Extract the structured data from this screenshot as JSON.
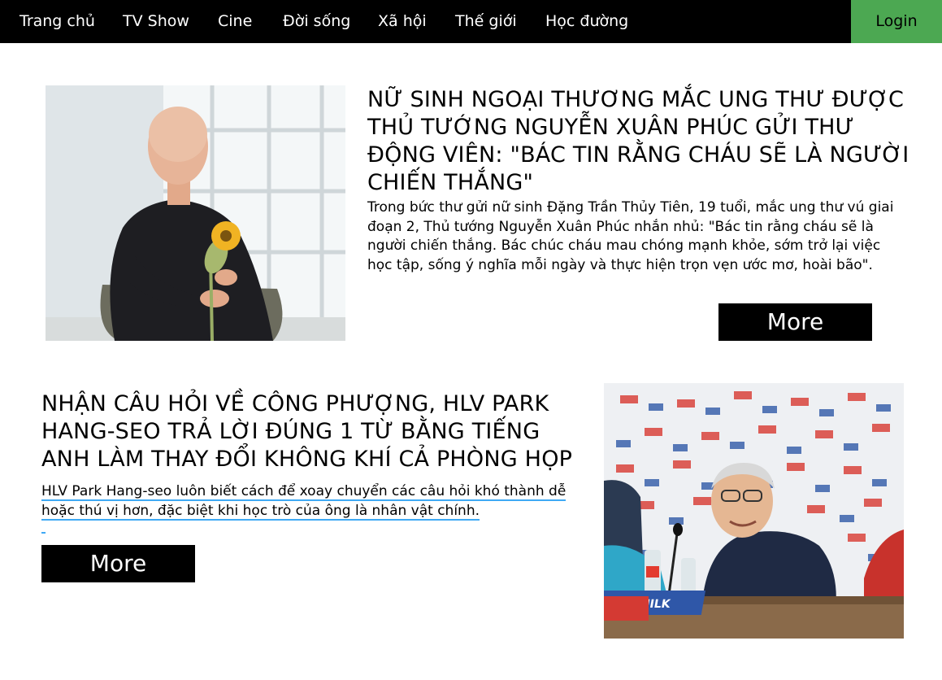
{
  "nav": {
    "items": [
      {
        "label": "Trang chủ"
      },
      {
        "label": "TV Show"
      },
      {
        "label": "Cine"
      },
      {
        "label": "Đời sống"
      },
      {
        "label": "Xã hội"
      },
      {
        "label": "Thế giới"
      },
      {
        "label": "Học đường"
      }
    ],
    "login_label": "Login",
    "login_color": "#4ca852"
  },
  "articles": [
    {
      "title": "NỮ SINH NGOẠI THƯƠNG MẮC UNG THƯ ĐƯỢC THỦ TƯỚNG NGUYỄN XUÂN PHÚC GỬI THƯ ĐỘNG VIÊN: \"BÁC TIN RẰNG CHÁU SẼ LÀ NGƯỜI CHIẾN THẮNG\"",
      "summary": "Trong bức thư gửi nữ sinh Đặng Trần Thủy Tiên, 19 tuổi, mắc ung thư vú giai đoạn 2, Thủ tướng Nguyễn Xuân Phúc nhắn nhủ: \"Bác tin rằng cháu sẽ là người chiến thắng. Bác chúc cháu mau chóng mạnh khỏe, sớm trở lại việc học tập, sống ý nghĩa mỗi ngày và thực hiện trọn vẹn ước mơ, hoài bão\".",
      "more_label": "More"
    },
    {
      "title": "NHẬN CÂU HỎI VỀ CÔNG PHƯỢNG, HLV PARK HANG-SEO TRẢ LỜI ĐÚNG 1 TỪ BẰNG TIẾNG ANH LÀM THAY ĐỔI KHÔNG KHÍ CẢ PHÒNG HỌP",
      "summary": "HLV Park Hang-seo luôn biết cách để xoay chuyển các câu hỏi khó thành dễ hoặc thú vị hơn, đặc biệt khi học trò của ông là nhân vật chính.",
      "more_label": "More"
    }
  ],
  "banner_text": "VINAMILK"
}
